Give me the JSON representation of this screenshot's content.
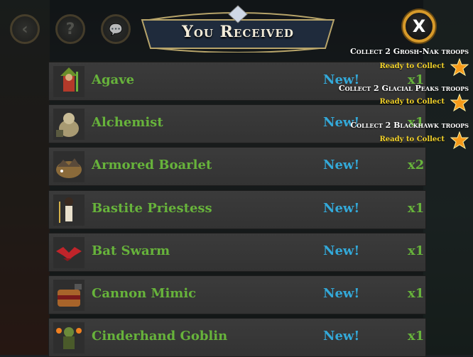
{
  "header": {
    "title": "You Received"
  },
  "top_buttons": {
    "back": "‹",
    "help": "?",
    "chat": "💬",
    "close": "X"
  },
  "items": [
    {
      "name": "Agave",
      "badge": "New!",
      "qty": "x1"
    },
    {
      "name": "Alchemist",
      "badge": "New!",
      "qty": "x1"
    },
    {
      "name": "Armored Boarlet",
      "badge": "New!",
      "qty": "x2"
    },
    {
      "name": "Bastite Priestess",
      "badge": "New!",
      "qty": "x1"
    },
    {
      "name": "Bat Swarm",
      "badge": "New!",
      "qty": "x1"
    },
    {
      "name": "Cannon Mimic",
      "badge": "New!",
      "qty": "x1"
    },
    {
      "name": "Cinderhand Goblin",
      "badge": "New!",
      "qty": "x1"
    }
  ],
  "quests": [
    {
      "title": "Collect 2 Grosh-Nak troops",
      "status": "Ready to Collect"
    },
    {
      "title": "Collect 2 Glacial Peaks troops",
      "status": "Ready to Collect"
    },
    {
      "title": "Collect 2 Blackhawk troops",
      "status": "Ready to Collect"
    }
  ],
  "colors": {
    "name_green": "#67b33b",
    "new_blue": "#33a9d9",
    "gold": "#d79a2a",
    "status_yellow": "#f2d22a"
  }
}
